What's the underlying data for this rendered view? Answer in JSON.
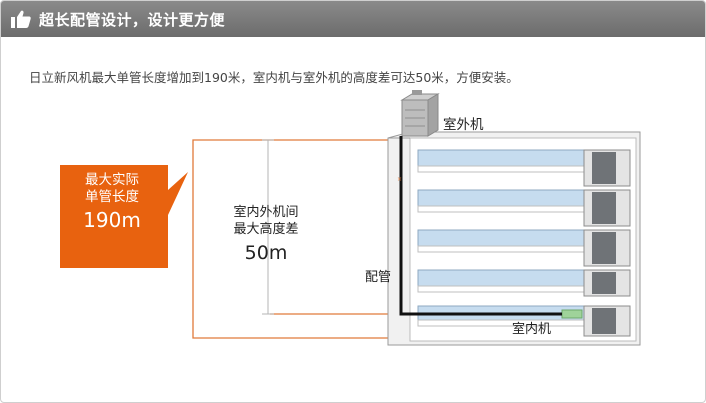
{
  "header": {
    "title": "超长配管设计，设计更方便"
  },
  "description": "日立新风机最大单管长度增加到190米，室内机与室外机的高度差可达50米，方便安装。",
  "diagram": {
    "callout": {
      "line1": "最大实际",
      "line2": "单管长度",
      "value": "190m"
    },
    "height_label": {
      "line1": "室内外机间",
      "line2": "最大高度差",
      "value": "50m"
    },
    "outdoor_unit_label": "室外机",
    "pipe_label": "配管",
    "indoor_unit_label": "室内机"
  },
  "colors": {
    "header_bg": "#777777",
    "accent_orange": "#e8620f",
    "guide_orange": "#e07a3a",
    "window_blue": "#c6dcef",
    "pipe_black": "#111111",
    "indoor_unit_green": "#9fd39a"
  },
  "icons": {
    "header": "thumbs-up-icon"
  }
}
